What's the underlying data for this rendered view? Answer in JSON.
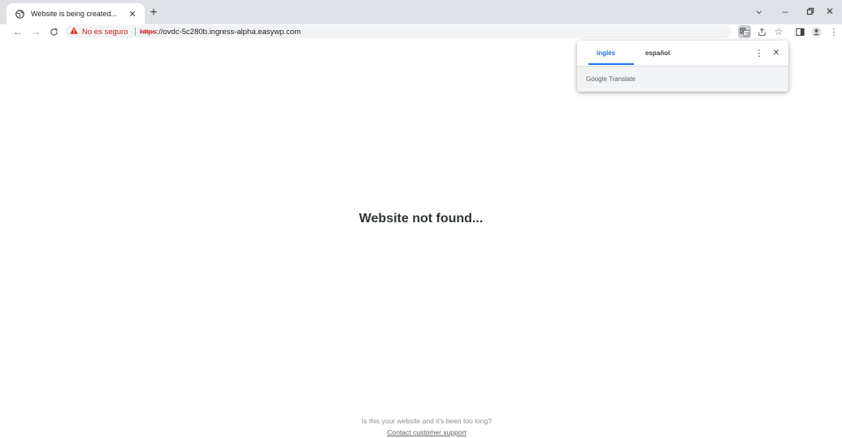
{
  "tab": {
    "title": "Website is being created...",
    "favicon": "globe-icon"
  },
  "toolbar": {
    "security_label": "No es seguro",
    "url_scheme": "https",
    "url_rest": "://ovdc-5c280b.ingress-alpha.easywp.com"
  },
  "translate_popup": {
    "tab_source": "inglés",
    "tab_target": "español",
    "brand": "Google Translate",
    "accent": "#1a73e8"
  },
  "page": {
    "heading": "Website not found...",
    "question": "Is this your website and it's been too long?",
    "support_link": "Contact customer support"
  }
}
